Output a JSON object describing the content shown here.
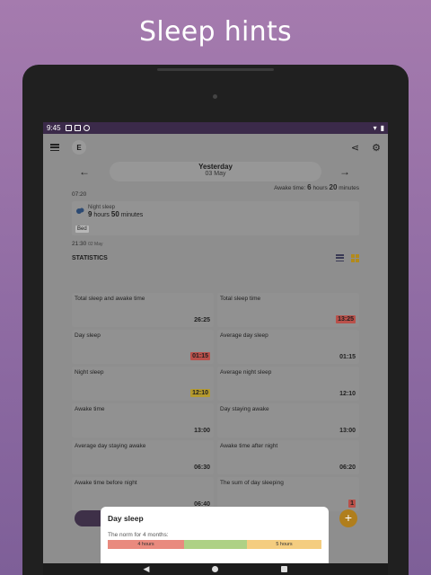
{
  "headline": "Sleep hints",
  "status": {
    "time": "9:45"
  },
  "header": {
    "avatar_letter": "E",
    "share_icon": "share-icon",
    "settings_icon": "gear-icon"
  },
  "date": {
    "day": "Yesterday",
    "date": "03 May"
  },
  "awake_time": {
    "label": "Awake time:",
    "hours": "6",
    "hours_unit": "hours",
    "minutes": "20",
    "minutes_unit": "minutes"
  },
  "timeline": {
    "start_time": "07:20",
    "night_sleep_label": "Night sleep",
    "night_hours": "9",
    "night_hours_unit": "hours",
    "night_minutes": "50",
    "night_minutes_unit": "minutes",
    "bed_tag": "Bed",
    "end_time": "21:30",
    "end_date": "02 May"
  },
  "statistics": {
    "title": "STATISTICS",
    "cells": [
      {
        "label": "Total sleep and awake time",
        "value": "26:25",
        "highlight": ""
      },
      {
        "label": "Total sleep time",
        "value": "13:25",
        "highlight": "red"
      },
      {
        "label": "Day sleep",
        "value": "01:15",
        "highlight": "red"
      },
      {
        "label": "Average day sleep",
        "value": "01:15",
        "highlight": ""
      },
      {
        "label": "Night sleep",
        "value": "12:10",
        "highlight": "yellow"
      },
      {
        "label": "Average night sleep",
        "value": "12:10",
        "highlight": ""
      },
      {
        "label": "Awake time",
        "value": "13:00",
        "highlight": ""
      },
      {
        "label": "Day staying awake",
        "value": "13:00",
        "highlight": ""
      },
      {
        "label": "Average day staying awake",
        "value": "06:30",
        "highlight": ""
      },
      {
        "label": "Awake time after night",
        "value": "06:20",
        "highlight": ""
      },
      {
        "label": "Awake time before night",
        "value": "06:40",
        "highlight": ""
      },
      {
        "label": "The sum of day sleeping",
        "value": "1",
        "highlight": "red"
      }
    ]
  },
  "fab": {
    "add_label": "+"
  },
  "sheet": {
    "title": "Day sleep",
    "norm_label": "The norm for 4 months:",
    "seg_low": "4 hours",
    "seg_mid": "",
    "seg_high": "5 hours",
    "colors": {
      "low": "#e98a7e",
      "mid": "#aed185",
      "high": "#f4cd80"
    }
  },
  "nav": {
    "back": "◀"
  }
}
